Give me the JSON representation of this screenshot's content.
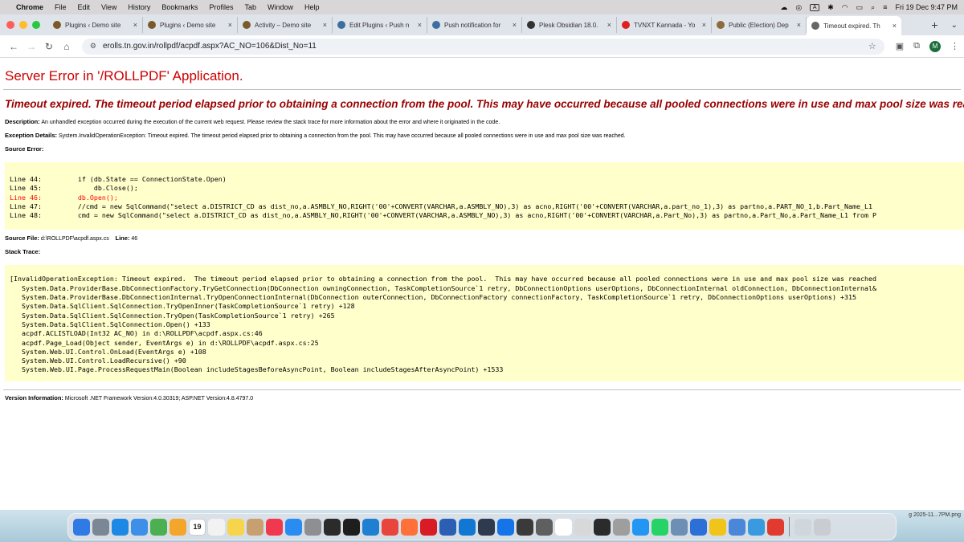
{
  "menubar": {
    "app_name": "Chrome",
    "menus": [
      "File",
      "Edit",
      "View",
      "History",
      "Bookmarks",
      "Profiles",
      "Tab",
      "Window",
      "Help"
    ],
    "input_indicator": "A",
    "datetime": "Fri 19 Dec  9:47 PM"
  },
  "tabs": [
    {
      "title": "Plugins ‹ Demo site",
      "icon": "wp-admin-icon",
      "color": "#7a5a2b"
    },
    {
      "title": "Plugins ‹ Demo site",
      "icon": "wp-admin-icon",
      "color": "#7a5a2b"
    },
    {
      "title": "Activity – Demo site",
      "icon": "wp-admin-icon",
      "color": "#7a5a2b"
    },
    {
      "title": "Edit Plugins ‹ Push n",
      "icon": "wordpress-icon",
      "color": "#3c6fa0"
    },
    {
      "title": "Push notification for",
      "icon": "wordpress-icon",
      "color": "#3c6fa0"
    },
    {
      "title": "Plesk Obsidian 18.0.",
      "icon": "plesk-icon",
      "color": "#333333"
    },
    {
      "title": "TVNXT Kannada - Yo",
      "icon": "youtube-icon",
      "color": "#e02020"
    },
    {
      "title": "Public (Election) Dep",
      "icon": "tn-emblem-icon",
      "color": "#8a6d3b"
    },
    {
      "title": "Timeout expired.  Th",
      "icon": "globe-icon",
      "color": "#666666",
      "active": true
    }
  ],
  "address": {
    "url": "erolls.tn.gov.in/rollpdf/acpdf.aspx?AC_NO=106&Dist_No=11"
  },
  "profile_initial": "M",
  "error": {
    "title": "Server Error in '/ROLLPDF' Application.",
    "message": "Timeout expired.  The timeout period elapsed prior to obtaining a connection from the pool.  This may have occurred because all pooled connections were in use and max pool size was reached.",
    "description_label": "Description:",
    "description": "An unhandled exception occurred during the execution of the current web request. Please review the stack trace for more information about the error and where it originated in the code.",
    "exception_label": "Exception Details:",
    "exception": "System.InvalidOperationException: Timeout expired.  The timeout period elapsed prior to obtaining a connection from the pool.  This may have occurred because all pooled connections were in use and max pool size was reached.",
    "source_error_label": "Source Error:",
    "source_lines": [
      {
        "text": "Line 44:         if (db.State == ConnectionState.Open)",
        "highlight": false
      },
      {
        "text": "Line 45:             db.Close();",
        "highlight": false
      },
      {
        "text": "Line 46:         db.Open();",
        "highlight": true
      },
      {
        "text": "Line 47:         //cmd = new SqlCommand(\"select a.DISTRICT_CD as dist_no,a.ASMBLY_NO,RIGHT('00'+CONVERT(VARCHAR,a.ASMBLY_NO),3) as acno,RIGHT('00'+CONVERT(VARCHAR,a.part_no_1),3) as partno,a.PART_NO_1,b.Part_Name_L1",
        "highlight": false
      },
      {
        "text": "Line 48:         cmd = new SqlCommand(\"select a.DISTRICT_CD as dist_no,a.ASMBLY_NO,RIGHT('00'+CONVERT(VARCHAR,a.ASMBLY_NO),3) as acno,RIGHT('00'+CONVERT(VARCHAR,a.Part_No),3) as partno,a.Part_No,a.Part_Name_L1 from P",
        "highlight": false
      }
    ],
    "source_file_label": "Source File:",
    "source_file": "d:\\ROLLPDF\\acpdf.aspx.cs",
    "line_label": "Line:",
    "line_number": "46",
    "stack_trace_label": "Stack Trace:",
    "stack_lines": [
      "[InvalidOperationException: Timeout expired.  The timeout period elapsed prior to obtaining a connection from the pool.  This may have occurred because all pooled connections were in use and max pool size was reached",
      "   System.Data.ProviderBase.DbConnectionFactory.TryGetConnection(DbConnection owningConnection, TaskCompletionSource`1 retry, DbConnectionOptions userOptions, DbConnectionInternal oldConnection, DbConnectionInternal&",
      "   System.Data.ProviderBase.DbConnectionInternal.TryOpenConnectionInternal(DbConnection outerConnection, DbConnectionFactory connectionFactory, TaskCompletionSource`1 retry, DbConnectionOptions userOptions) +315",
      "   System.Data.SqlClient.SqlConnection.TryOpenInner(TaskCompletionSource`1 retry) +128",
      "   System.Data.SqlClient.SqlConnection.TryOpen(TaskCompletionSource`1 retry) +265",
      "   System.Data.SqlClient.SqlConnection.Open() +133",
      "   acpdf.ACLISTLOAD(Int32 AC_NO) in d:\\ROLLPDF\\acpdf.aspx.cs:46",
      "   acpdf.Page_Load(Object sender, EventArgs e) in d:\\ROLLPDF\\acpdf.aspx.cs:25",
      "   System.Web.UI.Control.OnLoad(EventArgs e) +108",
      "   System.Web.UI.Control.LoadRecursive() +90",
      "   System.Web.UI.Page.ProcessRequestMain(Boolean includeStagesBeforeAsyncPoint, Boolean includeStagesAfterAsyncPoint) +1533"
    ],
    "version_label": "Version Information:",
    "version": "Microsoft .NET Framework Version:4.0.30319; ASP.NET Version:4.8.4797.0"
  },
  "dock": {
    "calendar_day": "19",
    "label": "g  2025-11...7PM.png",
    "apps": [
      {
        "name": "finder-icon",
        "color": "#2f7ae5"
      },
      {
        "name": "launchpad-icon",
        "color": "#7b8794"
      },
      {
        "name": "safari-icon",
        "color": "#1e88e5"
      },
      {
        "name": "mail-icon",
        "color": "#3d8fe8"
      },
      {
        "name": "maps-icon",
        "color": "#4caf50"
      },
      {
        "name": "photos-icon",
        "color": "#f4a62a"
      },
      {
        "name": "calendar-icon",
        "color": "#ffffff"
      },
      {
        "name": "reminders-icon",
        "color": "#f2f2f2"
      },
      {
        "name": "notes-icon",
        "color": "#f7d54a"
      },
      {
        "name": "contacts-icon",
        "color": "#c8a070"
      },
      {
        "name": "music-icon",
        "color": "#f0384f"
      },
      {
        "name": "app-store-icon",
        "color": "#2a8cf0"
      },
      {
        "name": "system-settings-icon",
        "color": "#8e8e93"
      },
      {
        "name": "activity-monitor-icon",
        "color": "#2b2b2b"
      },
      {
        "name": "terminal-icon",
        "color": "#1e1e1e"
      },
      {
        "name": "vscode-icon",
        "color": "#1f7fd0"
      },
      {
        "name": "chrome-icon",
        "color": "#e8453c"
      },
      {
        "name": "firefox-icon",
        "color": "#ff7139"
      },
      {
        "name": "opera-icon",
        "color": "#d81b24"
      },
      {
        "name": "word-icon",
        "color": "#2b5fb4"
      },
      {
        "name": "outlook-icon",
        "color": "#1277d2"
      },
      {
        "name": "anydesk-icon",
        "color": "#2e3a4d"
      },
      {
        "name": "xcode-icon",
        "color": "#1574e8"
      },
      {
        "name": "vpn-icon",
        "color": "#3a3a3a"
      },
      {
        "name": "calculator-icon",
        "color": "#5f5f5f"
      },
      {
        "name": "freeform-icon",
        "color": "#ffffff"
      },
      {
        "name": "help-icon",
        "color": "#d8d8d8"
      },
      {
        "name": "console-icon",
        "color": "#2b2b2b"
      },
      {
        "name": "printer-icon",
        "color": "#9e9e9e"
      },
      {
        "name": "print-video-icon",
        "color": "#2196f3"
      },
      {
        "name": "whatsapp-icon",
        "color": "#25d366"
      },
      {
        "name": "disk-utility-icon",
        "color": "#6d8fb3"
      },
      {
        "name": "font-book-icon",
        "color": "#2c6fd6"
      },
      {
        "name": "notes-app-icon",
        "color": "#f0c419"
      },
      {
        "name": "network-icon",
        "color": "#4b87d9"
      },
      {
        "name": "finder-window-icon",
        "color": "#3a9ae0"
      },
      {
        "name": "acrobat-icon",
        "color": "#e13a2f"
      },
      {
        "name": "downloads-icon",
        "color": "#cfd6dc"
      },
      {
        "name": "trash-icon",
        "color": "#c9cdd1"
      }
    ]
  }
}
